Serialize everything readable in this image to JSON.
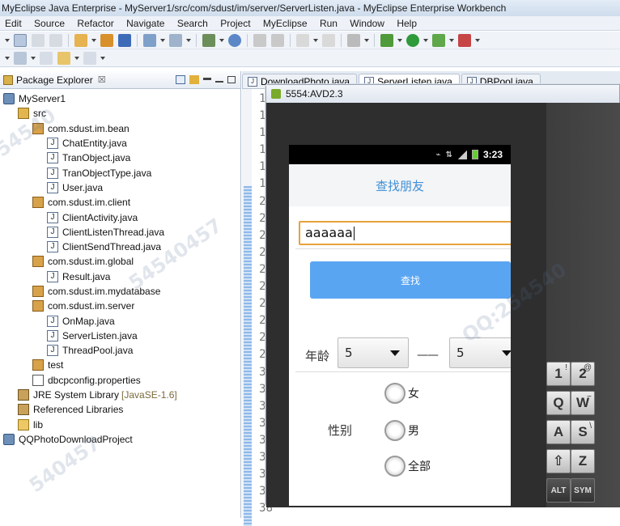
{
  "window": {
    "title": "MyEclipse Java Enterprise - MyServer1/src/com/sdust/im/server/ServerListen.java - MyEclipse Enterprise Workbench"
  },
  "menu": [
    "Edit",
    "Source",
    "Refactor",
    "Navigate",
    "Search",
    "Project",
    "MyEclipse",
    "Run",
    "Window",
    "Help"
  ],
  "explorer": {
    "title": "Package Explorer",
    "close": "☒",
    "tree": [
      {
        "label": "MyServer1",
        "depth": 1,
        "icon": "project-icon"
      },
      {
        "label": "src",
        "depth": 2,
        "icon": "source-folder-icon"
      },
      {
        "label": "com.sdust.im.bean",
        "depth": 3,
        "icon": "package-icon"
      },
      {
        "label": "ChatEntity.java",
        "depth": 4,
        "icon": "java-file-icon"
      },
      {
        "label": "TranObject.java",
        "depth": 4,
        "icon": "java-file-icon"
      },
      {
        "label": "TranObjectType.java",
        "depth": 4,
        "icon": "java-file-icon"
      },
      {
        "label": "User.java",
        "depth": 4,
        "icon": "java-file-icon"
      },
      {
        "label": "com.sdust.im.client",
        "depth": 3,
        "icon": "package-icon"
      },
      {
        "label": "ClientActivity.java",
        "depth": 4,
        "icon": "java-file-icon"
      },
      {
        "label": "ClientListenThread.java",
        "depth": 4,
        "icon": "java-file-icon"
      },
      {
        "label": "ClientSendThread.java",
        "depth": 4,
        "icon": "java-file-icon"
      },
      {
        "label": "com.sdust.im.global",
        "depth": 3,
        "icon": "package-icon"
      },
      {
        "label": "Result.java",
        "depth": 4,
        "icon": "java-file-icon"
      },
      {
        "label": "com.sdust.im.mydatabase",
        "depth": 3,
        "icon": "package-icon"
      },
      {
        "label": "com.sdust.im.server",
        "depth": 3,
        "icon": "package-icon"
      },
      {
        "label": "OnMap.java",
        "depth": 4,
        "icon": "java-file-icon"
      },
      {
        "label": "ServerListen.java",
        "depth": 4,
        "icon": "java-file-icon"
      },
      {
        "label": "ThreadPool.java",
        "depth": 4,
        "icon": "java-file-icon"
      },
      {
        "label": "test",
        "depth": 3,
        "icon": "package-icon"
      },
      {
        "label": "dbcpconfig.properties",
        "depth": 3,
        "icon": "properties-file-icon"
      },
      {
        "label": "JRE System Library",
        "suffix": "[JavaSE-1.6]",
        "depth": 2,
        "icon": "library-icon"
      },
      {
        "label": "Referenced Libraries",
        "depth": 2,
        "icon": "library-icon"
      },
      {
        "label": "lib",
        "depth": 2,
        "icon": "folder-icon"
      },
      {
        "label": "QQPhotoDownloadProject",
        "depth": 1,
        "icon": "project-icon"
      }
    ]
  },
  "editor": {
    "tabs": [
      "DownloadPhoto.java",
      "ServerListen.java",
      "DBPool.java"
    ],
    "active_tab": 1,
    "line_numbers": [
      "14",
      "15",
      "16",
      "17",
      "18",
      "19",
      "20",
      "21",
      "22",
      "23",
      "24",
      "25",
      "26",
      "27",
      "28",
      "29",
      "30",
      "31",
      "32",
      "33",
      "34",
      "35",
      "36",
      "37",
      "38"
    ]
  },
  "emulator": {
    "title": "5554:AVD2.3",
    "status_time": "3:23",
    "app_title": "查找朋友",
    "search_value": "aaaaaa",
    "search_button": "查找",
    "age_label": "年龄",
    "age_min": "5",
    "age_dash": "——",
    "age_max": "5",
    "gender_label": "性别",
    "gender_options": [
      "女",
      "男",
      "全部"
    ],
    "keys": [
      {
        "label": "1",
        "alt": "!"
      },
      {
        "label": "2",
        "alt": "@"
      },
      {
        "label": "Q",
        "alt": ""
      },
      {
        "label": "W",
        "alt": "~"
      },
      {
        "label": "A",
        "alt": ""
      },
      {
        "label": "S",
        "alt": "\\"
      },
      {
        "label": "⇧",
        "alt": ""
      },
      {
        "label": "Z",
        "alt": ""
      },
      {
        "label": "ALT",
        "alt": ""
      },
      {
        "label": "SYM",
        "alt": ""
      }
    ]
  },
  "colors": {
    "accent": "#3f8fd6",
    "button": "#5aa5f2",
    "focus": "#e7a23a"
  }
}
